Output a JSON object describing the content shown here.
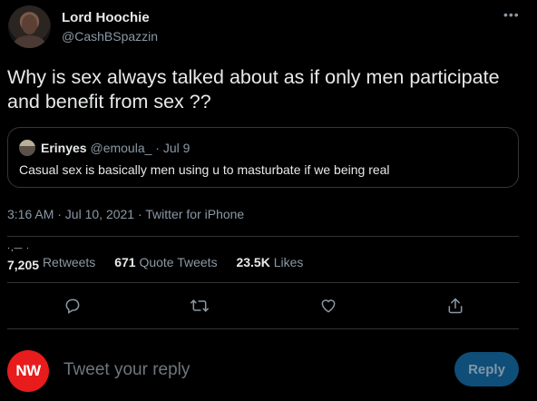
{
  "author": {
    "display_name": "Lord Hoochie",
    "handle": "@CashBSpazzin"
  },
  "more_icon": "more-horizontal-icon",
  "tweet": {
    "text": "Why is sex always talked about as if only men participate and benefit from sex ??"
  },
  "quote": {
    "name": "Erinyes",
    "handle": "@emoula_",
    "separator": "·",
    "date": "Jul 9",
    "text": "Casual sex is basically men using u to masturbate if we being real"
  },
  "meta": {
    "text": "3:16 AM · Jul 10, 2021 · Twitter for iPhone"
  },
  "stats": {
    "retweets": {
      "count": "7,205",
      "label": "Retweets"
    },
    "quote_tweets": {
      "count": "671",
      "label": "Quote Tweets"
    },
    "likes": {
      "count": "23.5K",
      "label": "Likes"
    }
  },
  "actions": [
    "reply-icon",
    "retweet-icon",
    "like-icon",
    "share-icon"
  ],
  "reply_bar": {
    "avatar_text": "NW",
    "placeholder": "Tweet your reply",
    "button_label": "Reply"
  },
  "colors": {
    "background": "#000000",
    "text_primary": "#e7e9ea",
    "text_secondary": "#8b98a5",
    "border": "#2f3336",
    "reply_button_disabled": "#0f4e78",
    "nw_badge": "#e81c1c"
  }
}
